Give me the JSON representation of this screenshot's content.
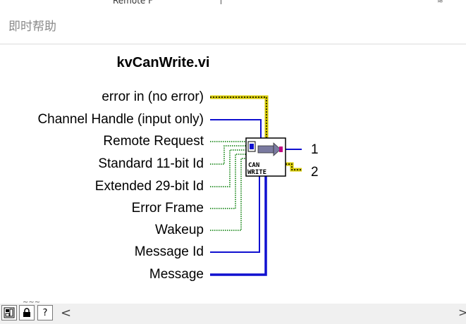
{
  "window": {
    "top_tab": "Remote F",
    "corner_glyph": "≋"
  },
  "help_window": {
    "title": "即时帮助"
  },
  "vi": {
    "name": "kvCanWrite.vi",
    "icon_text_line1": "CAN",
    "icon_text_line2": "WRITE",
    "inputs": [
      "error in (no error)",
      "Channel Handle (input only)",
      "Remote Request",
      "Standard 11-bit Id",
      "Extended 29-bit Id",
      "Error Frame",
      "Wakeup",
      "Message Id",
      "Message"
    ],
    "outputs": [
      "1",
      "2"
    ]
  },
  "colors": {
    "error_cluster": "#d4c800",
    "numeric_blue": "#1010d0",
    "boolean_green": "#007a00",
    "header_text": "#8a8a8a"
  },
  "toolbar": {
    "show_front_panel_icon": "front-panel-icon",
    "lock_icon": "lock-icon",
    "help_icon": "?",
    "scroll_left": "<",
    "scroll_right": ">",
    "partial_text": "~~~"
  }
}
